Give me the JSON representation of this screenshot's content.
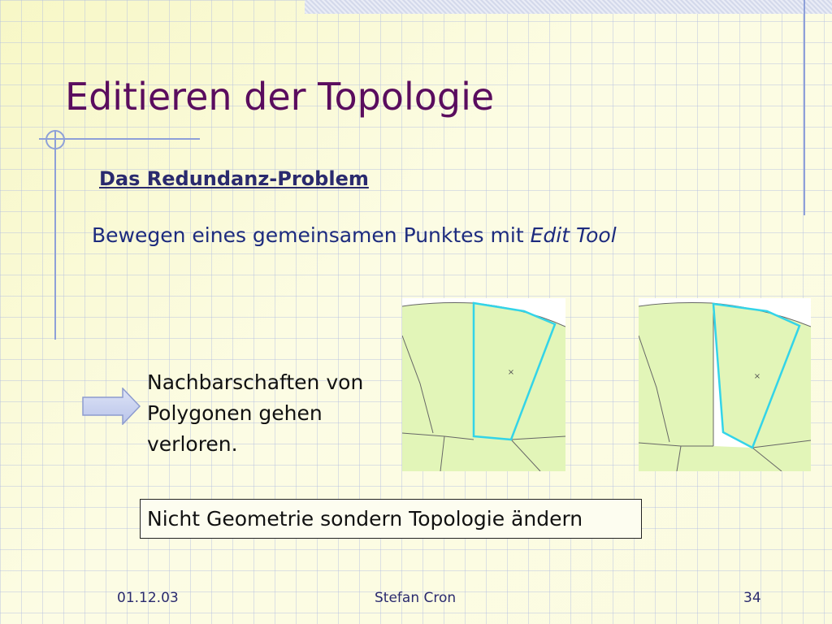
{
  "slide": {
    "title": "Editieren der Topologie",
    "subtitle": "Das Redundanz-Problem",
    "line1_prefix": "Bewegen eines gemeinsamen Punktes mit ",
    "line1_tool": "Edit Tool",
    "body": [
      "Nachbarschaften von",
      "Polygonen gehen",
      "verloren."
    ],
    "boxed_statement": "Nicht Geometrie sondern Topologie ändern"
  },
  "footer": {
    "date": "01.12.03",
    "author": "Stefan Cron",
    "page": "34"
  },
  "icons": {
    "arrow": "right-arrow-icon"
  },
  "colors": {
    "title": "#5a0d5e",
    "accent_text": "#1d2b7e",
    "polygon_fill": "#e2f5b8",
    "selection_outline": "#33d4e8",
    "decor_line": "#8ea0d8"
  }
}
